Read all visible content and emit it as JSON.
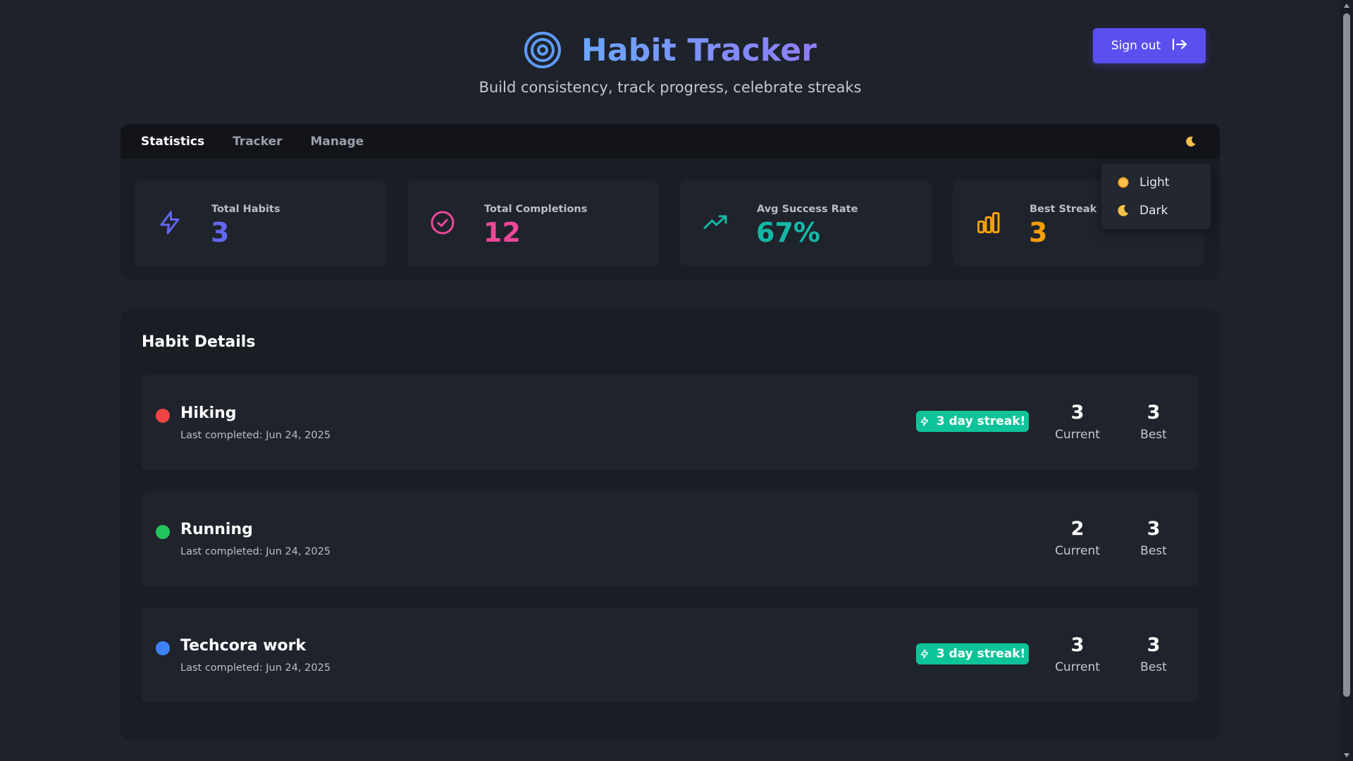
{
  "header": {
    "title": "Habit Tracker",
    "subtitle": "Build consistency, track progress, celebrate streaks",
    "logo_icon": "target-icon",
    "sign_out_label": "Sign out",
    "sign_out_icon": "log-out-icon"
  },
  "tabs": [
    {
      "label": "Statistics",
      "active": true
    },
    {
      "label": "Tracker",
      "active": false
    },
    {
      "label": "Manage",
      "active": false
    }
  ],
  "theme_toggle_icon": "moon-icon",
  "stats": [
    {
      "label": "Total Habits",
      "value": "3",
      "icon": "zap-icon",
      "color": "#6366f1"
    },
    {
      "label": "Total Completions",
      "value": "12",
      "icon": "check-circle-icon",
      "color": "#ec4899"
    },
    {
      "label": "Avg Success Rate",
      "value": "67%",
      "icon": "trending-up-icon",
      "color": "#14b8a6"
    },
    {
      "label": "Best Streak",
      "value": "3",
      "icon": "bar-chart-icon",
      "color": "#f59e0b"
    }
  ],
  "theme_menu": [
    {
      "label": "Light",
      "icon": "sun-icon"
    },
    {
      "label": "Dark",
      "icon": "moon-icon"
    }
  ],
  "details": {
    "title": "Habit Details",
    "current_label": "Current",
    "best_label": "Best",
    "habits": [
      {
        "name": "Hiking",
        "last_completed": "Last completed: Jun 24, 2025",
        "color": "#ef4444",
        "streak_badge": "3 day streak!",
        "current": "3",
        "best": "3"
      },
      {
        "name": "Running",
        "last_completed": "Last completed: Jun 24, 2025",
        "color": "#22c55e",
        "streak_badge": "",
        "current": "2",
        "best": "3"
      },
      {
        "name": "Techcora work",
        "last_completed": "Last completed: Jun 24, 2025",
        "color": "#3b82f6",
        "streak_badge": "3 day streak!",
        "current": "3",
        "best": "3"
      }
    ]
  }
}
